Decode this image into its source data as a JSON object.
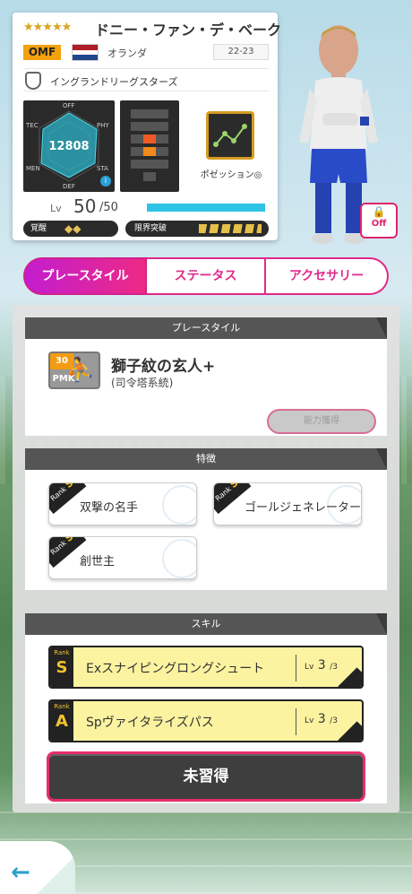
{
  "player": {
    "stars": "★★★★★",
    "name": "ドニー・ファン・デ・ベーク",
    "position": "OMF",
    "country": "オランダ",
    "season": "22-23",
    "club": "イングランドリーグスターズ",
    "rating": "12808",
    "position_label": "ポゼッション◎",
    "lv_label": "Lv",
    "lv": "50",
    "lv_max": "/50",
    "lv_progress": 1.0,
    "awakening_label": "覚醒",
    "awakening_value": "◆◆",
    "limit_label": "限界突破"
  },
  "radar_labels": {
    "off": "OFF",
    "tec": "TEC",
    "phy": "PHY",
    "men": "MEN",
    "sta": "STA",
    "def": "DEF"
  },
  "off_toggle": {
    "label": "Off"
  },
  "tabs": [
    {
      "label": "プレースタイル",
      "active": true
    },
    {
      "label": "ステータス"
    },
    {
      "label": "アクセサリー"
    }
  ],
  "playstyle": {
    "header": "プレースタイル",
    "icon_top": "30",
    "icon_bottom": "PMK",
    "name": "獅子紋の玄人+",
    "sub": "(司令塔系統)",
    "button": "能力獲得"
  },
  "traits": {
    "header": "特徴",
    "rank_label": "Rank",
    "items": [
      {
        "rank": "S",
        "name": "双撃の名手"
      },
      {
        "rank": "S",
        "name": "ゴールジェネレーター"
      },
      {
        "rank": "S",
        "name": "創世主"
      }
    ]
  },
  "skills": {
    "header": "スキル",
    "rank_label": "Rank",
    "lv_label": "Lv",
    "items": [
      {
        "rank": "S",
        "name": "Exスナイピングロングシュート",
        "lv": "3",
        "max": "/3"
      },
      {
        "rank": "A",
        "name": "Spヴァイタライズパス",
        "lv": "3",
        "max": "/3"
      }
    ],
    "learn_button": "未習得"
  },
  "colors": {
    "accent": "#e0298a",
    "gold": "#f3a10e",
    "cyan": "#2ec3e4"
  },
  "icons": {
    "back": "left-arrow-icon",
    "lock": "lock-icon"
  }
}
